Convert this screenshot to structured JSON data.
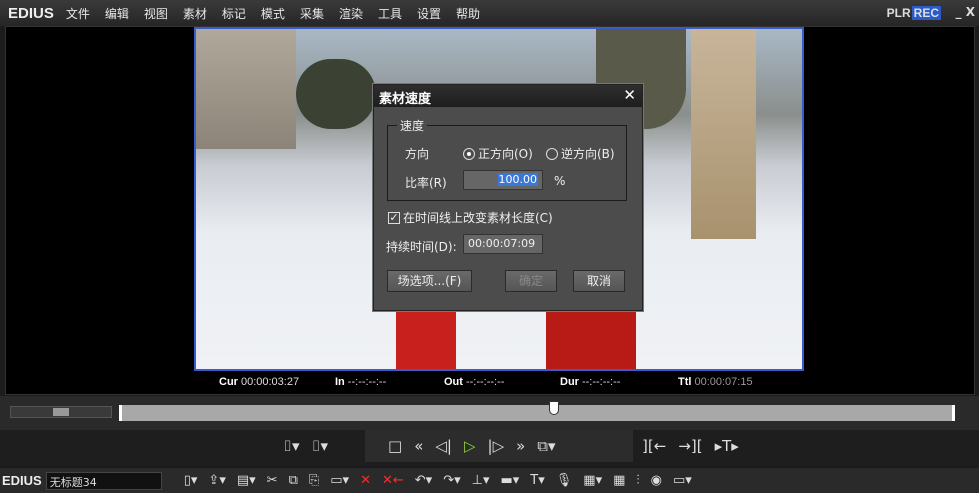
{
  "app": {
    "logo": "EDIUS",
    "plr": "PLR",
    "rec": "REC",
    "minimize": "_",
    "close": "X"
  },
  "menu": [
    "文件",
    "编辑",
    "视图",
    "素材",
    "标记",
    "模式",
    "采集",
    "渲染",
    "工具",
    "设置",
    "帮助"
  ],
  "timecodes": {
    "cur_label": "Cur",
    "cur": "00:00:03:27",
    "in_label": "In",
    "in": "--:--:--:--",
    "out_label": "Out",
    "out": "--:--:--:--",
    "dur_label": "Dur",
    "dur": "--:--:--:--",
    "ttl_label": "Ttl",
    "ttl": "00:00:07:15"
  },
  "playhead_fraction": 0.52,
  "dialog": {
    "title": "素材速度",
    "close": "✕",
    "group": "速度",
    "direction_label": "方向",
    "forward": "正方向(O)",
    "reverse": "逆方向(B)",
    "direction_selected": "forward",
    "rate_label": "比率(R)",
    "rate": "100.00",
    "rate_unit": "%",
    "change_length_label": "在时间线上改变素材长度(C)",
    "change_length_checked": true,
    "duration_label": "持续时间(D):",
    "duration": "00:00:07:09",
    "field_options": "场选项...(F)",
    "ok": "确定",
    "cancel": "取消"
  },
  "bottom": {
    "logo": "EDIUS",
    "project": "无标题34"
  },
  "colors": {
    "accent": "#3a5cc8",
    "play": "#8fd13a",
    "rec": "#2b5bc8"
  }
}
